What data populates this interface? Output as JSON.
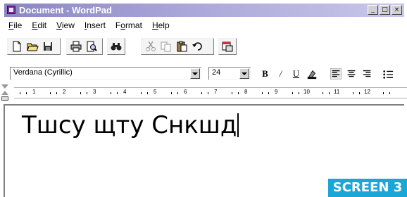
{
  "window": {
    "title": "Document - WordPad"
  },
  "menu": [
    "File",
    "Edit",
    "View",
    "Insert",
    "Format",
    "Help"
  ],
  "toolbar": {
    "buttons": [
      "new-document",
      "open",
      "save",
      "print",
      "print-preview",
      "find",
      "cut",
      "copy",
      "paste",
      "undo",
      "date-time"
    ]
  },
  "format": {
    "font_name": "Verdana (Cyrillic)",
    "font_size": "24",
    "bold_label": "B",
    "italic_label": "/",
    "underline_label": "U"
  },
  "ruler": {
    "numbers": [
      "1",
      "2",
      "3",
      "4",
      "5",
      "6",
      "7",
      "8",
      "9",
      "10",
      "11",
      "12"
    ]
  },
  "document": {
    "text": "Тшсу щту Снкшд"
  },
  "caption": "SCREEN 3"
}
